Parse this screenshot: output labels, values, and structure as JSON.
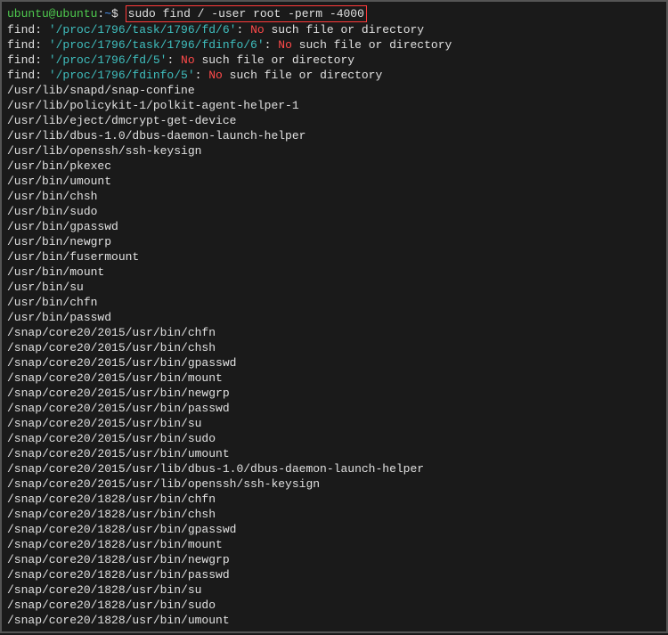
{
  "prompt": {
    "user": "ubuntu@ubuntu",
    "sep1": ":",
    "path": "~",
    "sep2": "$ "
  },
  "command": "sudo find / -user root -perm -4000",
  "errors": [
    {
      "pre": "find: ",
      "path": "'/proc/1796/task/1796/fd/6'",
      "mid": ": ",
      "no": "No",
      "post": " such file or directory"
    },
    {
      "pre": "find: ",
      "path": "'/proc/1796/task/1796/fdinfo/6'",
      "mid": ": ",
      "no": "No",
      "post": " such file or directory"
    },
    {
      "pre": "find: ",
      "path": "'/proc/1796/fd/5'",
      "mid": ": ",
      "no": "No",
      "post": " such file or directory"
    },
    {
      "pre": "find: ",
      "path": "'/proc/1796/fdinfo/5'",
      "mid": ": ",
      "no": "No",
      "post": " such file or directory"
    }
  ],
  "results": [
    "/usr/lib/snapd/snap-confine",
    "/usr/lib/policykit-1/polkit-agent-helper-1",
    "/usr/lib/eject/dmcrypt-get-device",
    "/usr/lib/dbus-1.0/dbus-daemon-launch-helper",
    "/usr/lib/openssh/ssh-keysign",
    "/usr/bin/pkexec",
    "/usr/bin/umount",
    "/usr/bin/chsh",
    "/usr/bin/sudo",
    "/usr/bin/gpasswd",
    "/usr/bin/newgrp",
    "/usr/bin/fusermount",
    "/usr/bin/mount",
    "/usr/bin/su",
    "/usr/bin/chfn",
    "/usr/bin/passwd",
    "/snap/core20/2015/usr/bin/chfn",
    "/snap/core20/2015/usr/bin/chsh",
    "/snap/core20/2015/usr/bin/gpasswd",
    "/snap/core20/2015/usr/bin/mount",
    "/snap/core20/2015/usr/bin/newgrp",
    "/snap/core20/2015/usr/bin/passwd",
    "/snap/core20/2015/usr/bin/su",
    "/snap/core20/2015/usr/bin/sudo",
    "/snap/core20/2015/usr/bin/umount",
    "/snap/core20/2015/usr/lib/dbus-1.0/dbus-daemon-launch-helper",
    "/snap/core20/2015/usr/lib/openssh/ssh-keysign",
    "/snap/core20/1828/usr/bin/chfn",
    "/snap/core20/1828/usr/bin/chsh",
    "/snap/core20/1828/usr/bin/gpasswd",
    "/snap/core20/1828/usr/bin/mount",
    "/snap/core20/1828/usr/bin/newgrp",
    "/snap/core20/1828/usr/bin/passwd",
    "/snap/core20/1828/usr/bin/su",
    "/snap/core20/1828/usr/bin/sudo",
    "/snap/core20/1828/usr/bin/umount"
  ]
}
